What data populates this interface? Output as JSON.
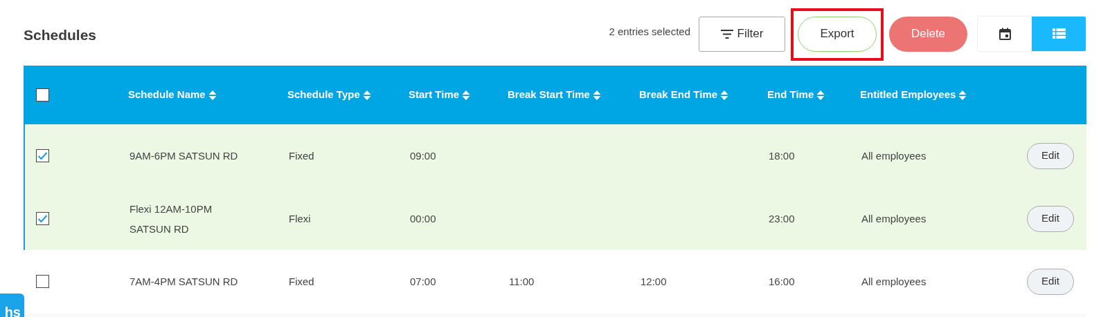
{
  "title": "Schedules",
  "selection_summary": "2 entries selected",
  "toolbar": {
    "filter": "Filter",
    "export": {
      "label": "Export",
      "highlighted": true
    },
    "delete": "Delete"
  },
  "view_toggle": [
    {
      "kind": "calendar",
      "selected": false
    },
    {
      "kind": "list",
      "selected": true
    }
  ],
  "table": {
    "all_checked": false,
    "columns": [
      "Schedule Name",
      "Schedule Type",
      "Start Time",
      "Break Start Time",
      "Break End Time",
      "End Time",
      "Entitled Employees"
    ],
    "rows": [
      {
        "checked": true,
        "cells": [
          "9AM-6PM SATSUN RD",
          "Fixed",
          "09:00",
          "",
          "",
          "18:00",
          "All employees"
        ],
        "action": "Edit"
      },
      {
        "checked": true,
        "cells": [
          "Flexi 12AM-10PM SATSUN RD",
          "Flexi",
          "00:00",
          "",
          "",
          "23:00",
          "All employees"
        ],
        "action": "Edit"
      },
      {
        "checked": false,
        "cells": [
          "7AM-4PM SATSUN RD",
          "Fixed",
          "07:00",
          "11:00",
          "12:00",
          "16:00",
          "All employees"
        ],
        "action": "Edit"
      }
    ]
  },
  "side_tab": {
    "label": "hs"
  }
}
